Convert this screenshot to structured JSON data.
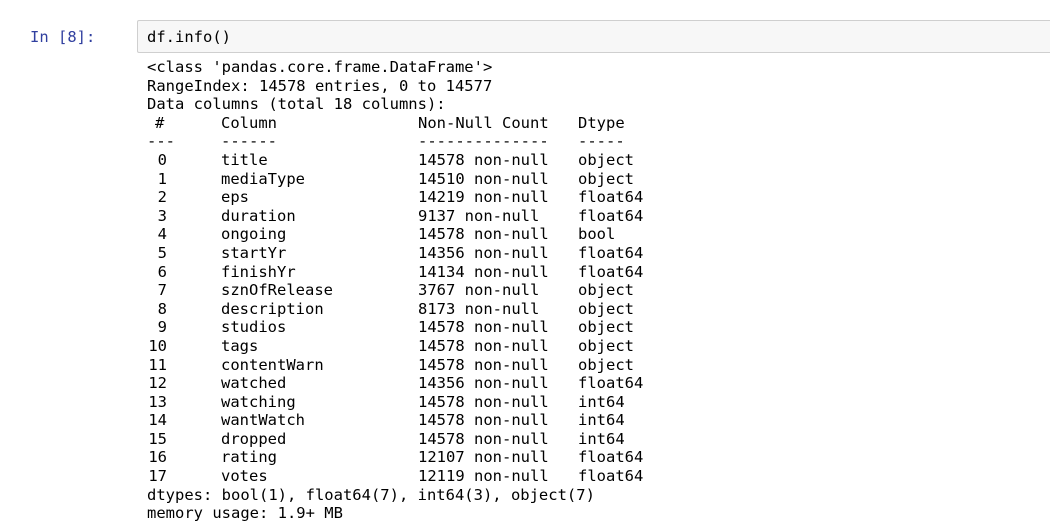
{
  "cell": {
    "prompt": "In [8]:",
    "input_code": "df.info()"
  },
  "output": {
    "class_line": "<class 'pandas.core.frame.DataFrame'>",
    "range_index": "RangeIndex: 14578 entries, 0 to 14577",
    "data_columns": "Data columns (total 18 columns):",
    "headers": {
      "index": "#",
      "column": "Column",
      "non_null": "Non-Null Count",
      "dtype": "Dtype"
    },
    "separators": {
      "index": "---",
      "column": "------",
      "non_null": "--------------",
      "dtype": "-----"
    },
    "rows": [
      {
        "index": "0",
        "column": "title",
        "non_null": "14578 non-null",
        "dtype": "object"
      },
      {
        "index": "1",
        "column": "mediaType",
        "non_null": "14510 non-null",
        "dtype": "object"
      },
      {
        "index": "2",
        "column": "eps",
        "non_null": "14219 non-null",
        "dtype": "float64"
      },
      {
        "index": "3",
        "column": "duration",
        "non_null": "9137 non-null",
        "dtype": "float64"
      },
      {
        "index": "4",
        "column": "ongoing",
        "non_null": "14578 non-null",
        "dtype": "bool"
      },
      {
        "index": "5",
        "column": "startYr",
        "non_null": "14356 non-null",
        "dtype": "float64"
      },
      {
        "index": "6",
        "column": "finishYr",
        "non_null": "14134 non-null",
        "dtype": "float64"
      },
      {
        "index": "7",
        "column": "sznOfRelease",
        "non_null": "3767 non-null",
        "dtype": "object"
      },
      {
        "index": "8",
        "column": "description",
        "non_null": "8173 non-null",
        "dtype": "object"
      },
      {
        "index": "9",
        "column": "studios",
        "non_null": "14578 non-null",
        "dtype": "object"
      },
      {
        "index": "10",
        "column": "tags",
        "non_null": "14578 non-null",
        "dtype": "object"
      },
      {
        "index": "11",
        "column": "contentWarn",
        "non_null": "14578 non-null",
        "dtype": "object"
      },
      {
        "index": "12",
        "column": "watched",
        "non_null": "14356 non-null",
        "dtype": "float64"
      },
      {
        "index": "13",
        "column": "watching",
        "non_null": "14578 non-null",
        "dtype": "int64"
      },
      {
        "index": "14",
        "column": "wantWatch",
        "non_null": "14578 non-null",
        "dtype": "int64"
      },
      {
        "index": "15",
        "column": "dropped",
        "non_null": "14578 non-null",
        "dtype": "int64"
      },
      {
        "index": "16",
        "column": "rating",
        "non_null": "12107 non-null",
        "dtype": "float64"
      },
      {
        "index": "17",
        "column": "votes",
        "non_null": "12119 non-null",
        "dtype": "float64"
      }
    ],
    "dtypes_line": "dtypes: bool(1), float64(7), int64(3), object(7)",
    "memory_line": "memory usage: 1.9+ MB"
  },
  "colors": {
    "prompt": "#303f9f",
    "input_bg": "#f7f7f7",
    "input_border": "#cfcfcf",
    "text": "#000000"
  }
}
